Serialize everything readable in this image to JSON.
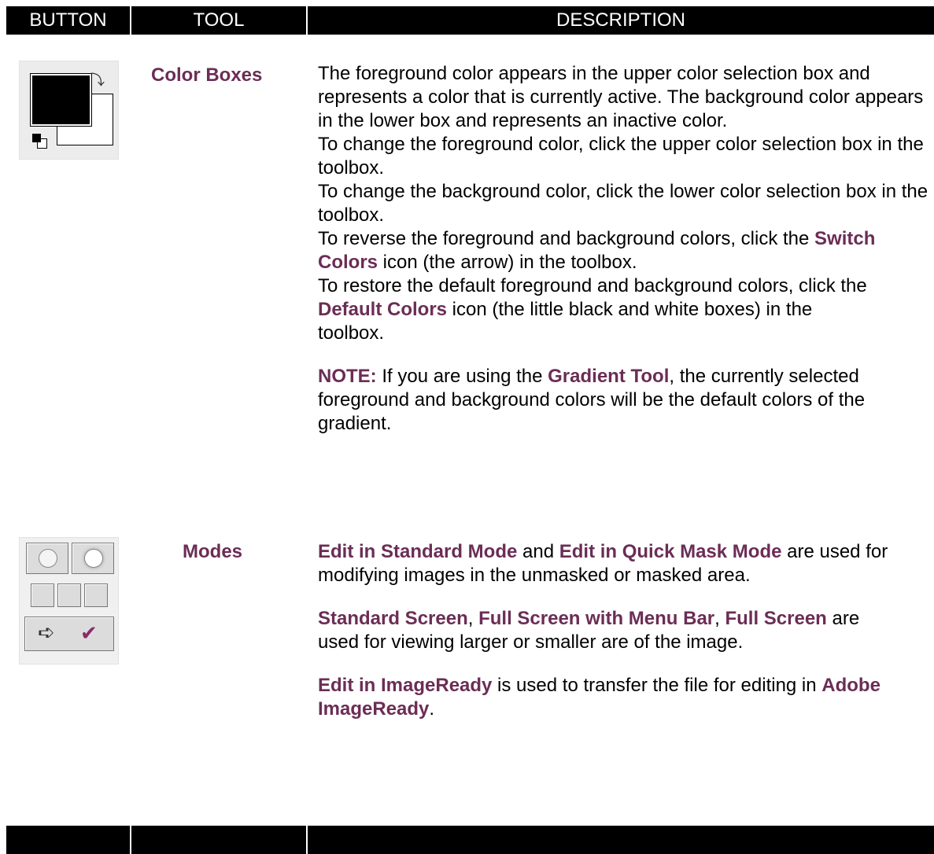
{
  "header": {
    "col_button": "BUTTON",
    "col_tool": "TOOL",
    "col_description": "DESCRIPTION"
  },
  "rows": [
    {
      "tool": "Color Boxes",
      "icon": "color-boxes-icon",
      "p1": "The foreground color appears in the upper color selection box and represents a color that is currently active. The background color appears in the lower box and represents an inactive color.",
      "p2": "To change the foreground color, click the upper color selection box in the toolbox.",
      "p3": "To change the background color, click the lower color selection box in the toolbox.",
      "p4_pre": "To reverse the foreground and background colors, click the ",
      "p4_term": "Switch Colors",
      "p4_post": " icon (the arrow) in the toolbox.",
      "p5_pre": "To restore the default foreground and background colors, click the ",
      "p5_term": "Default Colors",
      "p5_post": " icon (the little black and white boxes) in the toolbox.",
      "note_label": "NOTE:",
      "note_pre": " If you are using the ",
      "note_term": "Gradient Tool",
      "note_post": ", the currently selected foreground and background colors will be the default colors of the gradient."
    },
    {
      "tool": "Modes",
      "icon": "modes-icon",
      "a_term1": "Edit in Standard Mode",
      "a_mid": " and ",
      "a_term2": "Edit in Quick Mask Mode",
      "a_post": " are used for modifying images in the unmasked or masked area.",
      "b_term1": "Standard Screen",
      "b_sep1": ", ",
      "b_term2": "Full Screen with Menu Bar",
      "b_sep2": ", ",
      "b_term3": "Full Screen",
      "b_post": " are used for viewing larger or smaller are of the image.",
      "c_term1": "Edit in ImageReady",
      "c_mid": " is used to transfer the file for editing in ",
      "c_term2": "Adobe ImageReady",
      "c_post": "."
    }
  ],
  "colors": {
    "term": "#6b2d55",
    "header_bg": "#000000",
    "header_text": "#ffffff"
  }
}
